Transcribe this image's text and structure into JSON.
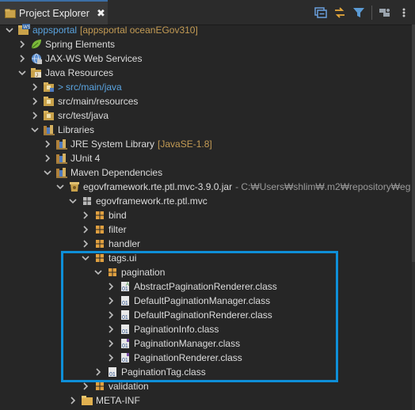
{
  "view": {
    "title": "Project Explorer",
    "close_glyph": "✖"
  },
  "toolbar": {
    "buttons": [
      "collapse-all-icon",
      "link-with-editor-icon",
      "filter-icon",
      "focus-icon",
      "view-menu-icon"
    ]
  },
  "tree": {
    "project": {
      "label": "appsportal",
      "deco": "[appsportal oceanEGov310]",
      "badge": "WS"
    },
    "spring": {
      "label": "Spring Elements"
    },
    "jaxws": {
      "label": "JAX-WS Web Services"
    },
    "javares": {
      "label": "Java Resources"
    },
    "srcmain": {
      "prefix": ">",
      "label": "src/main/java"
    },
    "srcres": {
      "label": "src/main/resources"
    },
    "srctest": {
      "label": "src/test/java"
    },
    "libraries": {
      "label": "Libraries"
    },
    "jre": {
      "label": "JRE System Library",
      "deco": "[JavaSE-1.8]"
    },
    "junit": {
      "label": "JUnit 4"
    },
    "maven": {
      "label": "Maven Dependencies"
    },
    "jar": {
      "label": "egovframework.rte.ptl.mvc-3.9.0.jar",
      "deco": "- C:₩Users₩shlim₩.m2₩repository₩eg"
    },
    "pkg": {
      "label": "egovframework.rte.ptl.mvc"
    },
    "bind": {
      "label": "bind"
    },
    "filter": {
      "label": "filter"
    },
    "handler": {
      "label": "handler"
    },
    "tagsui": {
      "label": "tags.ui"
    },
    "pagination": {
      "label": "pagination"
    },
    "classes": [
      {
        "label": "AbstractPaginationRenderer.class"
      },
      {
        "label": "DefaultPaginationManager.class"
      },
      {
        "label": "DefaultPaginationRenderer.class"
      },
      {
        "label": "PaginationInfo.class"
      },
      {
        "label": "PaginationManager.class"
      },
      {
        "label": "PaginationRenderer.class"
      }
    ],
    "paginationtag": {
      "label": "PaginationTag.class"
    },
    "validation": {
      "label": "validation"
    },
    "metainf": {
      "label": "META-INF"
    }
  },
  "colors": {
    "background": "#262626",
    "highlight_box": "#0e8fd8",
    "decoration": "#c39b54",
    "link_blue": "#5aa4e0"
  }
}
